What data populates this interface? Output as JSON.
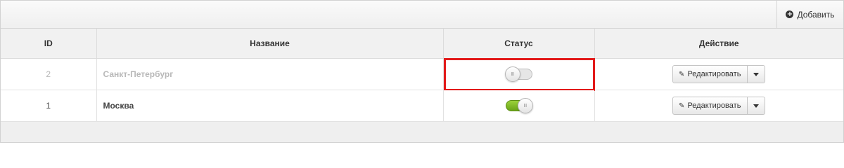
{
  "toolbar": {
    "add_label": "Добавить",
    "add_icon": "plus-circle-icon"
  },
  "table": {
    "headers": {
      "id": "ID",
      "name": "Название",
      "status": "Статус",
      "action": "Действие"
    },
    "rows": [
      {
        "id": "2",
        "name": "Санкт-Петербург",
        "status_on": false,
        "edit_label": "Редактировать",
        "highlighted": true
      },
      {
        "id": "1",
        "name": "Москва",
        "status_on": true,
        "edit_label": "Редактировать",
        "highlighted": false
      }
    ]
  },
  "colors": {
    "highlight": "#e21a1a",
    "toggle_on": "#7fba26"
  }
}
